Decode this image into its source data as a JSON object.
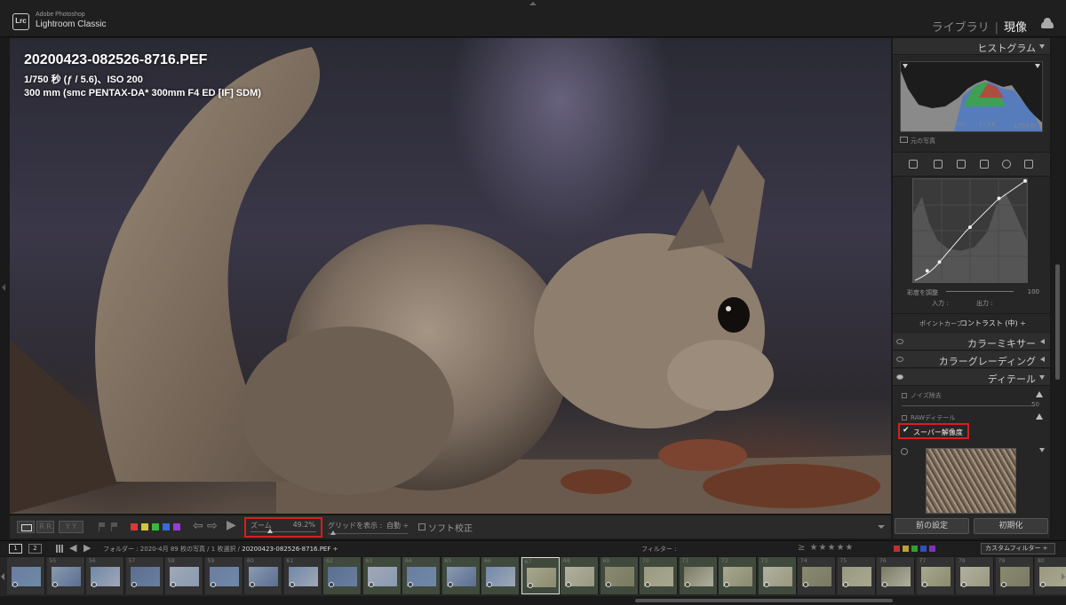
{
  "app": {
    "brand_top": "Adobe Photoshop",
    "brand_name": "Lightroom Classic",
    "logo": "Lrc"
  },
  "modules": {
    "library": "ライブラリ",
    "separator": "|",
    "develop": "現像"
  },
  "photo": {
    "filename": "20200423-082526-8716.PEF",
    "exposure": "1/750 秒 (ƒ / 5.6)、ISO 200",
    "lens": "300 mm (smc PENTAX-DA* 300mm F4 ED [IF] SDM)"
  },
  "toolbar": {
    "zoom_label": "ズーム",
    "zoom_value": "49.2%",
    "zoom_fraction": 0.3,
    "grid_label": "グリッドを表示 :",
    "grid_value": "自動 ÷",
    "softproof_label": "ソフト校正",
    "view_ba1": "R R",
    "view_ba2": "Y Y",
    "color_labels": [
      "#d83a3a",
      "#d8c43a",
      "#3ab83a",
      "#3a6ad8",
      "#9a3ad8"
    ]
  },
  "histogram": {
    "title": "ヒストグラム",
    "iso": "ISO 200",
    "focal": "300 mm",
    "aperture": "ƒ / 5.6",
    "shutter": "1/750 秒",
    "original_photo": "元の写真"
  },
  "tone_curve": {
    "saturation_label": "彩度を調整",
    "saturation_value": "100",
    "input_label": "入力 :",
    "output_label": "出力 :",
    "point_curve_label": "ポイントカーブ :",
    "point_curve_value": "コントラスト (中) ÷"
  },
  "panels": {
    "color_mixer": "カラーミキサー",
    "color_grading": "カラーグレーディング",
    "detail": "ディテール"
  },
  "detail": {
    "noise_reduction": "ノイズ除去",
    "noise_value": "50",
    "raw_detail": "RAWディテール",
    "super_resolution": "スーパー解像度",
    "check": "✔"
  },
  "buttons": {
    "previous": "前の設定",
    "reset": "初期化"
  },
  "filmstrip_header": {
    "tab1": "1",
    "tab2": "2",
    "path_prefix": "フォルダー : 2020-4月 89 枚の写真 / 1 枚選択 / ",
    "filename": "20200423-082526-8716.PEF ÷",
    "filter_label": "フィルター :",
    "stars": "≥ ★★★★★",
    "custom_filter": "カスタムフィルター ÷",
    "filter_colors": [
      "#c03030",
      "#c0a030",
      "#30a030",
      "#3050c0",
      "#8030c0"
    ]
  },
  "filmstrip": {
    "numbers": [
      "",
      "55",
      "56",
      "57",
      "58",
      "59",
      "60",
      "61",
      "62",
      "63",
      "64",
      "65",
      "66",
      "67",
      "68",
      "69",
      "70",
      "71",
      "72",
      "73",
      "74",
      "75",
      "76",
      "77",
      "78",
      "79",
      "80"
    ],
    "selected_index": 13
  }
}
